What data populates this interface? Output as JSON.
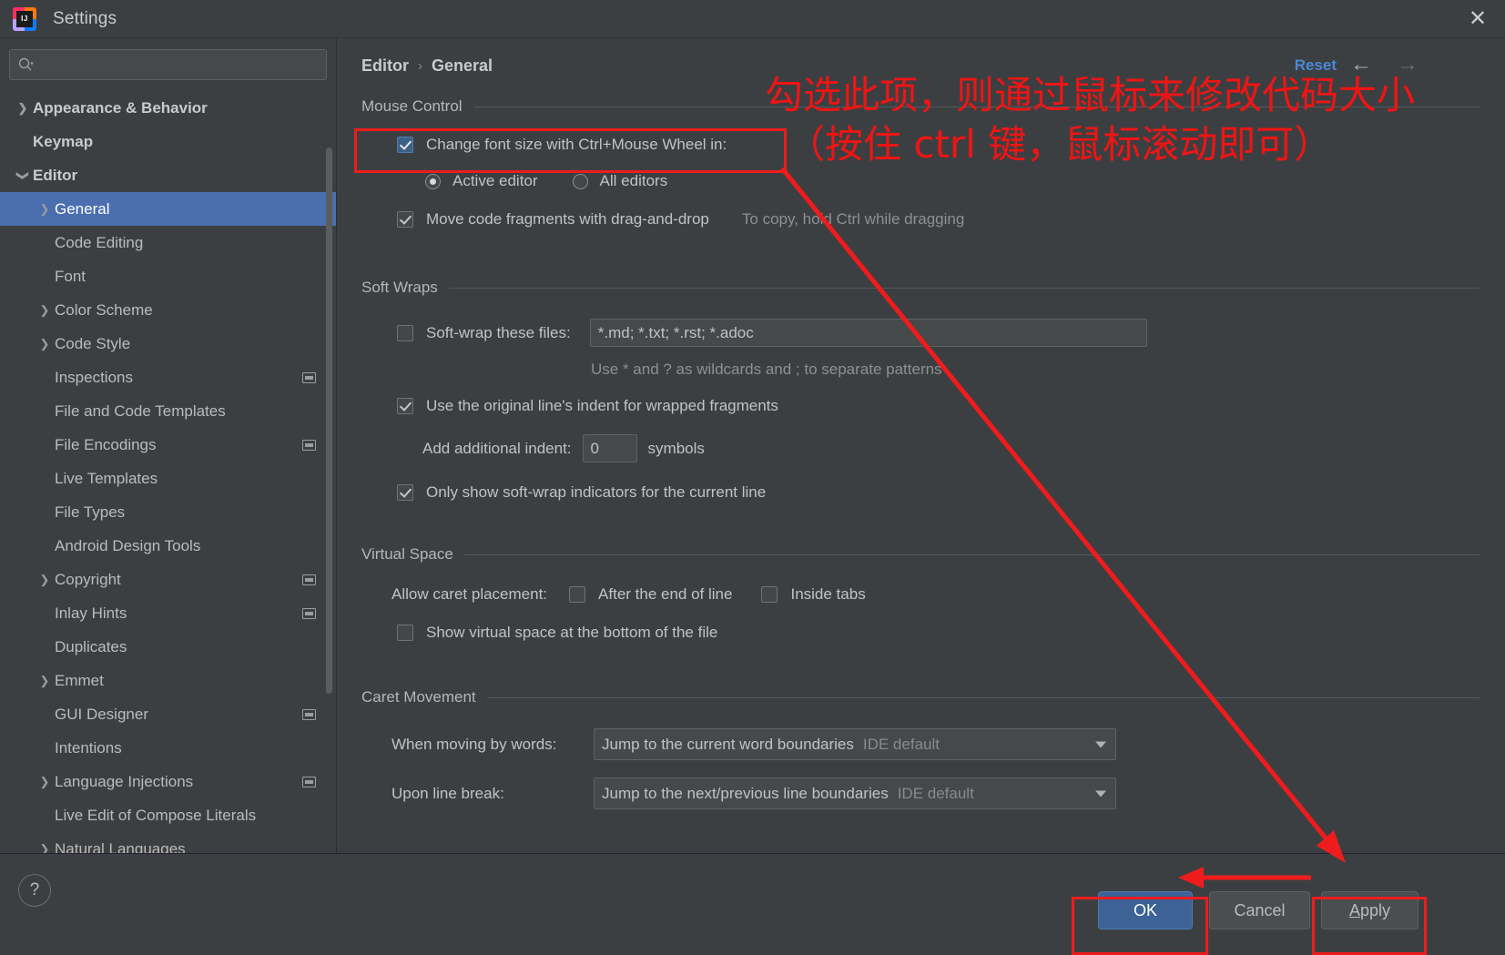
{
  "window": {
    "title": "Settings",
    "logo_text": "IJ",
    "close_icon": "✕"
  },
  "search": {
    "placeholder": "",
    "value": ""
  },
  "sidebar": {
    "items": [
      {
        "label": "Appearance & Behavior",
        "level": 0,
        "arrow": "right",
        "bold": true,
        "badge": false,
        "selected": false
      },
      {
        "label": "Keymap",
        "level": 0,
        "arrow": "none",
        "bold": true,
        "badge": false,
        "selected": false
      },
      {
        "label": "Editor",
        "level": 0,
        "arrow": "down",
        "bold": true,
        "badge": false,
        "selected": false
      },
      {
        "label": "General",
        "level": 1,
        "arrow": "right",
        "bold": false,
        "badge": false,
        "selected": true
      },
      {
        "label": "Code Editing",
        "level": 1,
        "arrow": "none",
        "bold": false,
        "badge": false,
        "selected": false
      },
      {
        "label": "Font",
        "level": 1,
        "arrow": "none",
        "bold": false,
        "badge": false,
        "selected": false
      },
      {
        "label": "Color Scheme",
        "level": 1,
        "arrow": "right",
        "bold": false,
        "badge": false,
        "selected": false
      },
      {
        "label": "Code Style",
        "level": 1,
        "arrow": "right",
        "bold": false,
        "badge": false,
        "selected": false
      },
      {
        "label": "Inspections",
        "level": 1,
        "arrow": "none",
        "bold": false,
        "badge": true,
        "selected": false
      },
      {
        "label": "File and Code Templates",
        "level": 1,
        "arrow": "none",
        "bold": false,
        "badge": false,
        "selected": false
      },
      {
        "label": "File Encodings",
        "level": 1,
        "arrow": "none",
        "bold": false,
        "badge": true,
        "selected": false
      },
      {
        "label": "Live Templates",
        "level": 1,
        "arrow": "none",
        "bold": false,
        "badge": false,
        "selected": false
      },
      {
        "label": "File Types",
        "level": 1,
        "arrow": "none",
        "bold": false,
        "badge": false,
        "selected": false
      },
      {
        "label": "Android Design Tools",
        "level": 1,
        "arrow": "none",
        "bold": false,
        "badge": false,
        "selected": false
      },
      {
        "label": "Copyright",
        "level": 1,
        "arrow": "right",
        "bold": false,
        "badge": true,
        "selected": false
      },
      {
        "label": "Inlay Hints",
        "level": 1,
        "arrow": "none",
        "bold": false,
        "badge": true,
        "selected": false
      },
      {
        "label": "Duplicates",
        "level": 1,
        "arrow": "none",
        "bold": false,
        "badge": false,
        "selected": false
      },
      {
        "label": "Emmet",
        "level": 1,
        "arrow": "right",
        "bold": false,
        "badge": false,
        "selected": false
      },
      {
        "label": "GUI Designer",
        "level": 1,
        "arrow": "none",
        "bold": false,
        "badge": true,
        "selected": false
      },
      {
        "label": "Intentions",
        "level": 1,
        "arrow": "none",
        "bold": false,
        "badge": false,
        "selected": false
      },
      {
        "label": "Language Injections",
        "level": 1,
        "arrow": "right",
        "bold": false,
        "badge": true,
        "selected": false
      },
      {
        "label": "Live Edit of Compose Literals",
        "level": 1,
        "arrow": "none",
        "bold": false,
        "badge": false,
        "selected": false
      },
      {
        "label": "Natural Languages",
        "level": 1,
        "arrow": "right",
        "bold": false,
        "badge": false,
        "selected": false
      }
    ]
  },
  "main": {
    "breadcrumb": {
      "parent": "Editor",
      "separator": "›",
      "current": "General"
    },
    "reset_label": "Reset",
    "nav_back_icon": "←",
    "nav_forward_icon": "→",
    "mouse_control": {
      "title": "Mouse Control",
      "change_font_size_label": "Change font size with Ctrl+Mouse Wheel in:",
      "change_font_size_checked": true,
      "scope_active_label": "Active editor",
      "scope_all_label": "All editors",
      "scope_selected": "Active editor",
      "move_fragments_label": "Move code fragments with drag-and-drop",
      "move_fragments_checked": true,
      "move_fragments_hint": "To copy, hold Ctrl while dragging"
    },
    "soft_wraps": {
      "title": "Soft Wraps",
      "soft_wrap_files_label": "Soft-wrap these files:",
      "soft_wrap_files_checked": false,
      "soft_wrap_files_value": "*.md; *.txt; *.rst; *.adoc",
      "wildcards_hint": "Use * and ? as wildcards and ; to separate patterns",
      "original_indent_label": "Use the original line's indent for wrapped fragments",
      "original_indent_checked": true,
      "add_indent_label": "Add additional indent:",
      "add_indent_value": "0",
      "add_indent_suffix": "symbols",
      "only_show_indicators_label": "Only show soft-wrap indicators for the current line",
      "only_show_indicators_checked": true
    },
    "virtual_space": {
      "title": "Virtual Space",
      "allow_caret_label": "Allow caret placement:",
      "after_eol_label": "After the end of line",
      "after_eol_checked": false,
      "inside_tabs_label": "Inside tabs",
      "inside_tabs_checked": false,
      "show_virtual_space_label": "Show virtual space at the bottom of the file",
      "show_virtual_space_checked": false
    },
    "caret_movement": {
      "title": "Caret Movement",
      "when_moving_label": "When moving by words:",
      "when_moving_value": "Jump to the current word boundaries",
      "when_moving_suffix": "IDE default",
      "upon_line_break_label": "Upon line break:",
      "upon_line_break_value": "Jump to the next/previous line boundaries",
      "upon_line_break_suffix": "IDE default"
    }
  },
  "footer": {
    "help_label": "?",
    "ok_label": "OK",
    "cancel_label": "Cancel",
    "apply_label_prefix": "A",
    "apply_label_rest": "pply"
  },
  "annotations": {
    "line1": "勾选此项，则通过鼠标来修改代码大小",
    "line2": "（按住 ctrl 键，鼠标滚动即可）",
    "color": "#f01414"
  }
}
